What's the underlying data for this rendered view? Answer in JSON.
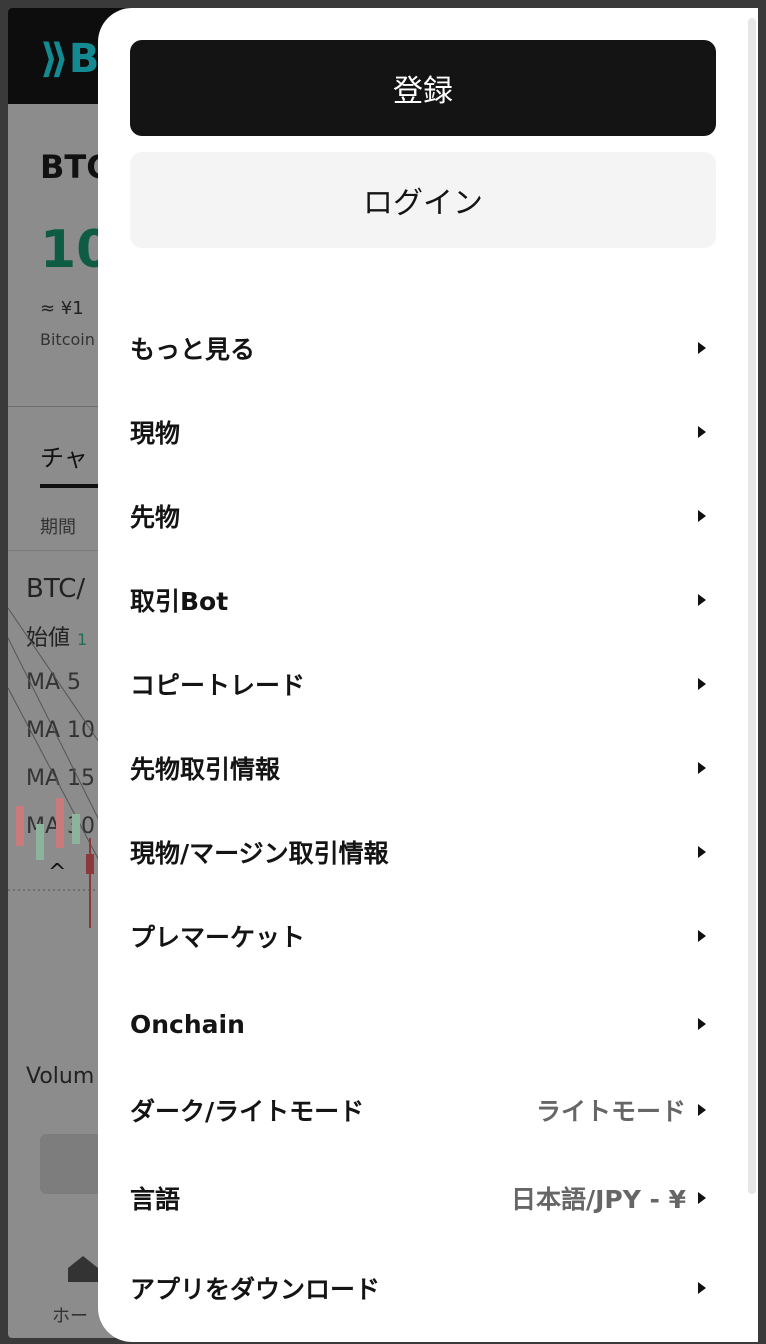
{
  "background": {
    "logo_text": "B",
    "pair": "BTC",
    "price": "10",
    "approx": "≈ ¥1",
    "coin_name": "Bitcoin",
    "tab_chart": "チャ",
    "period": "期間",
    "chart_title": "BTC/",
    "open_label": "始値",
    "open_value": "1",
    "ma": [
      "MA 5",
      "MA 10",
      "MA 15",
      "MA 30"
    ],
    "collapse": "^",
    "volume": "Volum",
    "home_label": "ホー"
  },
  "drawer": {
    "register_label": "登録",
    "login_label": "ログイン",
    "menu": [
      {
        "label": "もっと見る",
        "value": ""
      },
      {
        "label": "現物",
        "value": ""
      },
      {
        "label": "先物",
        "value": ""
      },
      {
        "label": "取引Bot",
        "value": ""
      },
      {
        "label": "コピートレード",
        "value": ""
      },
      {
        "label": "先物取引情報",
        "value": ""
      },
      {
        "label": "現物/マージン取引情報",
        "value": ""
      },
      {
        "label": "プレマーケット",
        "value": ""
      },
      {
        "label": "Onchain",
        "value": ""
      },
      {
        "label": "ダーク/ライトモード",
        "value": "ライトモード"
      },
      {
        "label": "言語",
        "value": "日本語/JPY - ¥"
      },
      {
        "label": "アプリをダウンロード",
        "value": ""
      }
    ]
  },
  "colors": {
    "register_bg": "#141414",
    "login_bg": "#f4f4f4",
    "overlay": "#8c8c8c"
  }
}
